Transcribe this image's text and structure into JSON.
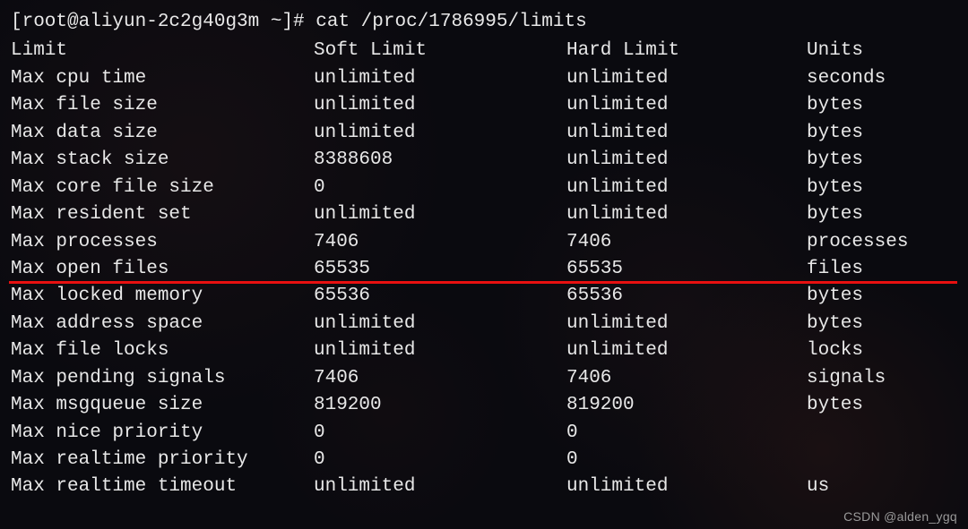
{
  "prompt": "[root@aliyun-2c2g40g3m ~]# cat /proc/1786995/limits",
  "header": {
    "limit": "Limit",
    "soft": "Soft Limit",
    "hard": "Hard Limit",
    "units": "Units"
  },
  "rows": [
    {
      "limit": "Max cpu time",
      "soft": "unlimited",
      "hard": "unlimited",
      "units": "seconds"
    },
    {
      "limit": "Max file size",
      "soft": "unlimited",
      "hard": "unlimited",
      "units": "bytes"
    },
    {
      "limit": "Max data size",
      "soft": "unlimited",
      "hard": "unlimited",
      "units": "bytes"
    },
    {
      "limit": "Max stack size",
      "soft": "8388608",
      "hard": "unlimited",
      "units": "bytes"
    },
    {
      "limit": "Max core file size",
      "soft": "0",
      "hard": "unlimited",
      "units": "bytes"
    },
    {
      "limit": "Max resident set",
      "soft": "unlimited",
      "hard": "unlimited",
      "units": "bytes"
    },
    {
      "limit": "Max processes",
      "soft": "7406",
      "hard": "7406",
      "units": "processes"
    },
    {
      "limit": "Max open files",
      "soft": "65535",
      "hard": "65535",
      "units": "files"
    },
    {
      "limit": "Max locked memory",
      "soft": "65536",
      "hard": "65536",
      "units": "bytes"
    },
    {
      "limit": "Max address space",
      "soft": "unlimited",
      "hard": "unlimited",
      "units": "bytes"
    },
    {
      "limit": "Max file locks",
      "soft": "unlimited",
      "hard": "unlimited",
      "units": "locks"
    },
    {
      "limit": "Max pending signals",
      "soft": "7406",
      "hard": "7406",
      "units": "signals"
    },
    {
      "limit": "Max msgqueue size",
      "soft": "819200",
      "hard": "819200",
      "units": "bytes"
    },
    {
      "limit": "Max nice priority",
      "soft": "0",
      "hard": "0",
      "units": ""
    },
    {
      "limit": "Max realtime priority",
      "soft": "0",
      "hard": "0",
      "units": ""
    },
    {
      "limit": "Max realtime timeout",
      "soft": "unlimited",
      "hard": "unlimited",
      "units": "us"
    }
  ],
  "highlight_after_index": 7,
  "watermark": "CSDN @alden_ygq"
}
